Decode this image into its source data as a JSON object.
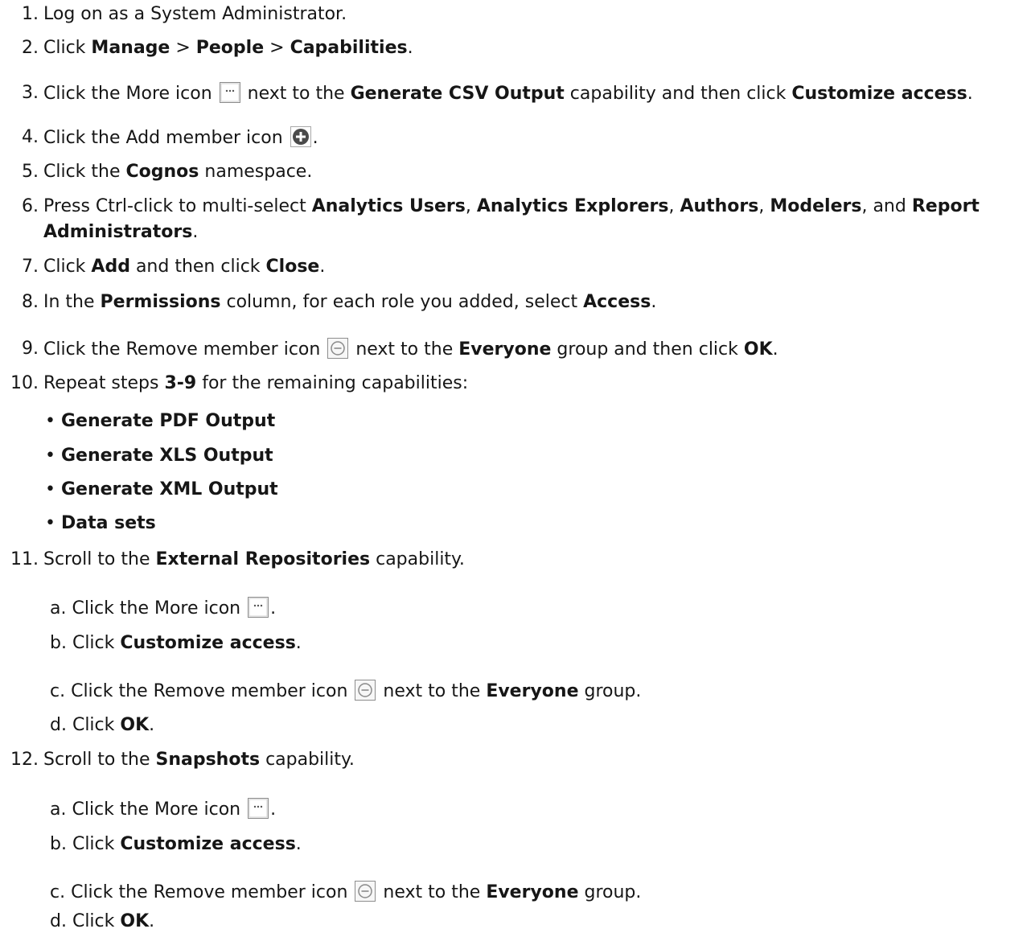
{
  "steps": {
    "s1": {
      "num": "1.",
      "text": "Log on as a System Administrator."
    },
    "s2": {
      "num": "2.",
      "pre": "Click ",
      "b1": "Manage",
      "sep1": " > ",
      "b2": "People",
      "sep2": " > ",
      "b3": "Capabilities",
      "post": "."
    },
    "s3": {
      "num": "3.",
      "pre": "Click the More icon ",
      "mid1": " next to the ",
      "b1": "Generate CSV Output",
      "mid2": " capability and then click ",
      "b2": "Customize access",
      "post": "."
    },
    "s4": {
      "num": "4.",
      "pre": "Click the Add member icon ",
      "post": "."
    },
    "s5": {
      "num": "5.",
      "pre": "Click the ",
      "b1": "Cognos",
      "post": " namespace."
    },
    "s6": {
      "num": "6.",
      "pre": "Press Ctrl-click to multi-select ",
      "b1": "Analytics Users",
      "c1": ", ",
      "b2": "Analytics Explorers",
      "c2": ", ",
      "b3": "Authors",
      "c3": ", ",
      "b4": "Modelers",
      "c4": ", and ",
      "b5": "Report",
      "b6": "Administrators",
      "post": "."
    },
    "s7": {
      "num": "7.",
      "pre": "Click ",
      "b1": "Add",
      "mid": " and then click ",
      "b2": "Close",
      "post": "."
    },
    "s8": {
      "num": "8.",
      "pre": "In the ",
      "b1": "Permissions",
      "mid": " column, for each role you added, select ",
      "b2": "Access",
      "post": "."
    },
    "s9": {
      "num": "9.",
      "pre": "Click the Remove member icon ",
      "mid": " next to the ",
      "b1": "Everyone",
      "mid2": " group and then click ",
      "b2": "OK",
      "post": "."
    },
    "s10": {
      "num": "10.",
      "pre": "Repeat steps ",
      "b1": "3-9",
      "post": " for the remaining capabilities:",
      "bullets": [
        "Generate PDF Output",
        "Generate XLS Output",
        "Generate XML Output",
        "Data sets"
      ]
    },
    "s11": {
      "num": "11.",
      "pre": "Scroll to the ",
      "b1": "External Repositories",
      "post": " capability.",
      "a": {
        "pre": "a. Click the More icon ",
        "post": "."
      },
      "b": {
        "pre": "b. Click ",
        "b1": "Customize access",
        "post": "."
      },
      "c": {
        "pre": "c. Click the Remove member icon ",
        "mid": " next to the ",
        "b1": "Everyone",
        "post": " group."
      },
      "d": {
        "pre": "d. Click ",
        "b1": "OK",
        "post": "."
      }
    },
    "s12": {
      "num": "12.",
      "pre": "Scroll to the ",
      "b1": "Snapshots",
      "post": " capability.",
      "a": {
        "pre": "a. Click the More icon ",
        "post": "."
      },
      "b": {
        "pre": "b. Click ",
        "b1": "Customize access",
        "post": "."
      },
      "c": {
        "pre": "c. Click the Remove member icon ",
        "mid": " next to the ",
        "b1": "Everyone",
        "post": " group."
      },
      "d": {
        "pre": "d. Click ",
        "b1": "OK",
        "post": "."
      }
    }
  },
  "icons": {
    "more": "more-icon",
    "add_member": "add-member-icon",
    "remove_member": "remove-member-icon",
    "remove_color": "#8a8a8a",
    "add_color": "#4a4a4a"
  }
}
